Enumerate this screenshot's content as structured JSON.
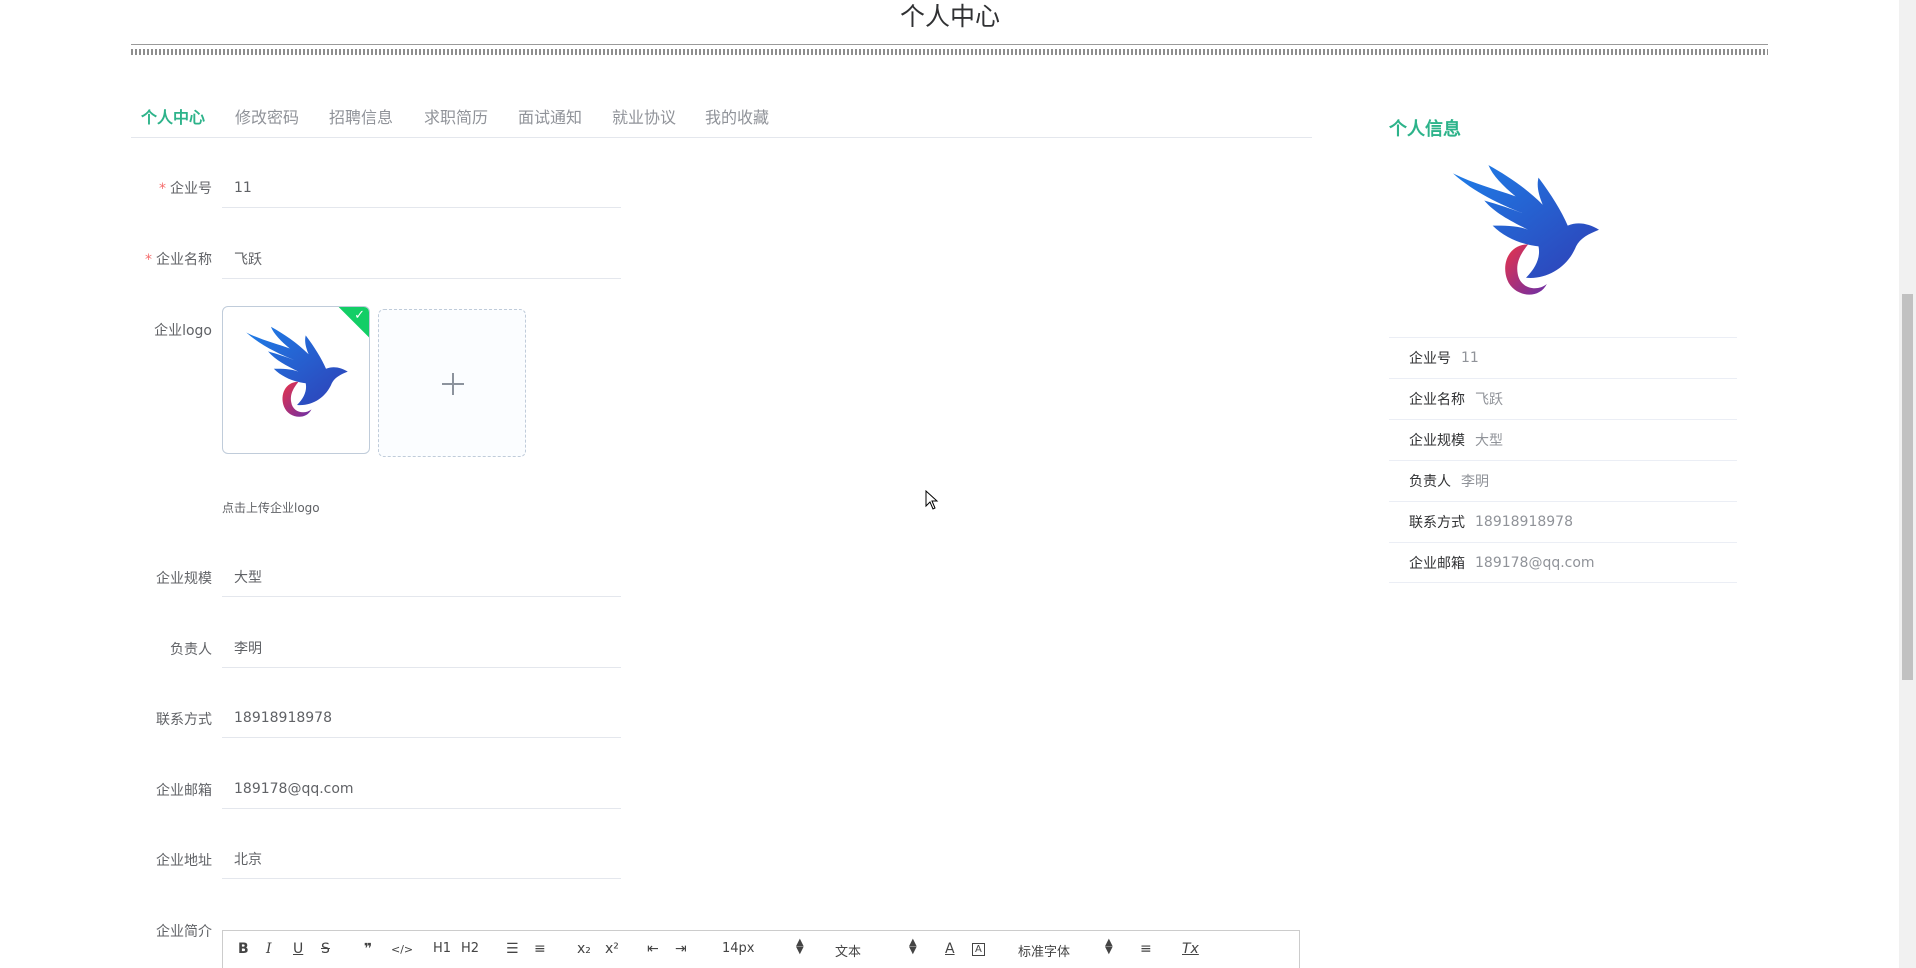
{
  "page": {
    "title": "个人中心"
  },
  "tabs": [
    {
      "label": "个人中心",
      "active": true
    },
    {
      "label": "修改密码"
    },
    {
      "label": "招聘信息"
    },
    {
      "label": "求职简历"
    },
    {
      "label": "面试通知"
    },
    {
      "label": "就业协议"
    },
    {
      "label": "我的收藏"
    }
  ],
  "form": {
    "company_no": {
      "label": "企业号",
      "value": "11",
      "required": true
    },
    "company_name": {
      "label": "企业名称",
      "value": "飞跃",
      "required": true
    },
    "logo": {
      "label": "企业logo",
      "tip": "点击上传企业logo"
    },
    "scale": {
      "label": "企业规模",
      "value": "大型"
    },
    "contact_person": {
      "label": "负责人",
      "value": "李明"
    },
    "phone": {
      "label": "联系方式",
      "value": "18918918978"
    },
    "email": {
      "label": "企业邮箱",
      "value": "189178@qq.com"
    },
    "address": {
      "label": "企业地址",
      "value": "北京"
    },
    "intro": {
      "label": "企业简介"
    }
  },
  "editor_toolbar": {
    "bold": "B",
    "italic": "I",
    "underline": "U",
    "strike": "S",
    "blockquote": "❞",
    "code": "</>",
    "h1": "H1",
    "h2": "H2",
    "subscript": "x₂",
    "superscript": "x²",
    "font_size": "14px",
    "header_select": "文本",
    "font_family": "标准字体",
    "clean": "Tx"
  },
  "info": {
    "title": "个人信息",
    "rows": [
      {
        "key": "企业号",
        "value": "11"
      },
      {
        "key": "企业名称",
        "value": "飞跃"
      },
      {
        "key": "企业规模",
        "value": "大型"
      },
      {
        "key": "负责人",
        "value": "李明"
      },
      {
        "key": "联系方式",
        "value": "18918918978"
      },
      {
        "key": "企业邮箱",
        "value": "189178@qq.com"
      }
    ]
  },
  "colors": {
    "accent": "#2db38a",
    "required": "#f56c6c",
    "upload_success": "#13ce66"
  }
}
